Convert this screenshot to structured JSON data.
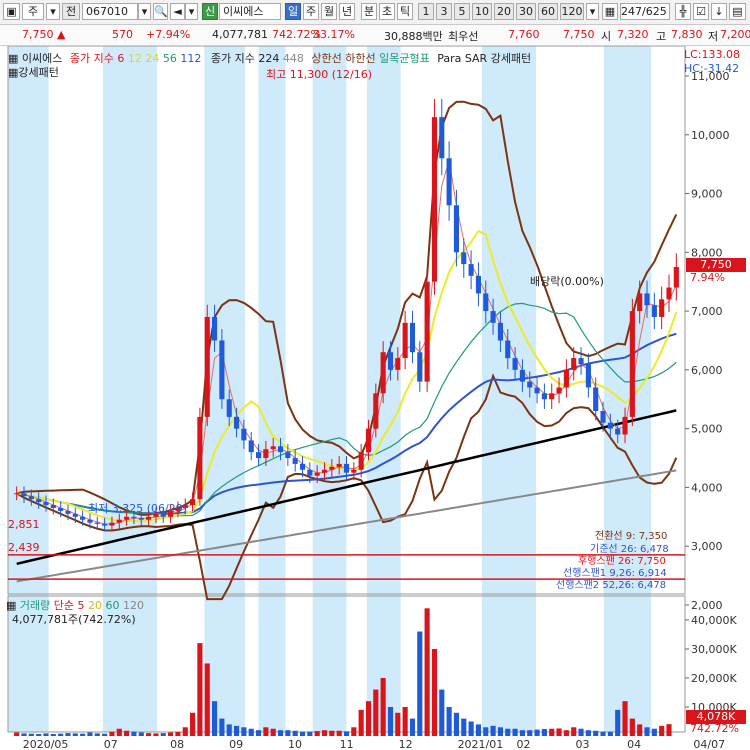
{
  "toolbar": {
    "type_label": "주",
    "period_label": "전",
    "code": "067010",
    "sin_badge": "신",
    "stock_name": "이씨에스",
    "periods": [
      "일",
      "주",
      "월",
      "년"
    ],
    "minute_btn": "분",
    "tick_btn": "초",
    "tick2_btn": "틱",
    "intervals": [
      "1",
      "3",
      "5",
      "10",
      "20",
      "30",
      "60",
      "120"
    ],
    "record_count": "247/625"
  },
  "info": {
    "price": "7,750",
    "change": "570",
    "change_pct": "+7.94%",
    "volume": "4,077,781",
    "volume_pct": "742.72%",
    "turnover_pct": "33.17%",
    "amount": "30,888백만",
    "best_bid_label": "최우선",
    "best_bid": "7,760",
    "best_ask": "7,750",
    "open_label": "시",
    "open": "7,320",
    "high_label": "고",
    "high": "7,830",
    "low_label": "저",
    "low": "7,200"
  },
  "colors": {
    "up": "#d9141a",
    "down": "#1f5bd8",
    "shade": "#cfeafb",
    "ma5": "#e66b6b",
    "ma20": "#ebeb28",
    "ma60": "#1f9a7a",
    "ma120": "#2f55c8",
    "ma224": "#000000",
    "ma448": "#888888",
    "bollinger": "#7a3410",
    "hline": "#d9141a"
  },
  "price_legend": {
    "name": "이씨에스",
    "ma_title": "종가 지수 6",
    "ma_values": [
      "12",
      "24",
      "56",
      "112"
    ],
    "ma2_title": "종가 지수 224",
    "ma2_values": [
      "448"
    ],
    "bands_upper": "상한선",
    "bands_lower": "하한선",
    "ichimoku": "일목균형표",
    "para": "Para SAR 강세패턴",
    "second_line": "강세패턴",
    "lc": "LC:133.08",
    "hc": "HC:-31.42"
  },
  "volume_legend": {
    "title": "거래량",
    "simple": "단순 5",
    "ma": [
      "20",
      "60",
      "120"
    ],
    "current": "4,077,781주(742.72%)"
  },
  "annotations": {
    "high_note": "최고 11,300 (12/16)",
    "low_note": "최저 3,325 (06/29)",
    "dividend": "배당락(0.00%)"
  },
  "right_labels": {
    "price_tag": "7,750",
    "pct_tag": "7.94%",
    "vol_tag": "4,078K",
    "vol_pct_tag": "742.72%"
  },
  "ichimoku_labels": [
    "전환선 9: 7,350",
    "기준선 26: 6,478",
    "후행스팬 26: 7,750",
    "선행스팬1 9,26: 6,914",
    "선행스팬2 52,26: 6,478"
  ],
  "hlines": [
    "2,851",
    "2,439"
  ],
  "chart_data": {
    "type": "line",
    "price_axis": {
      "min": 2000,
      "max": 11000,
      "ticks": [
        "2,000",
        "3,000",
        "4,000",
        "5,000",
        "6,000",
        "7,000",
        "8,000",
        "9,000",
        "10,000",
        "11,000"
      ]
    },
    "volume_axis": {
      "max": 40000,
      "ticks": [
        "10,000K",
        "20,000K",
        "30,000K",
        "40,000K"
      ]
    },
    "x_labels": [
      "2020/05",
      "07",
      "08",
      "09",
      "10",
      "11",
      "12",
      "2021/01",
      "02",
      "03",
      "04",
      "04/07"
    ],
    "close": [
      3900,
      3850,
      3800,
      3750,
      3700,
      3650,
      3600,
      3550,
      3500,
      3450,
      3400,
      3380,
      3350,
      3400,
      3450,
      3500,
      3480,
      3450,
      3500,
      3550,
      3500,
      3600,
      3650,
      3700,
      3800,
      5200,
      6900,
      6500,
      5500,
      5200,
      5000,
      4800,
      4600,
      4500,
      4650,
      4700,
      4600,
      4500,
      4400,
      4300,
      4200,
      4250,
      4300,
      4350,
      4400,
      4250,
      4300,
      4600,
      5000,
      5600,
      6300,
      6000,
      6200,
      6800,
      6300,
      5800,
      7500,
      10300,
      9600,
      8800,
      8000,
      7800,
      7600,
      7300,
      7000,
      6800,
      6500,
      6200,
      6000,
      5800,
      5700,
      5600,
      5500,
      5600,
      5700,
      6000,
      6200,
      6100,
      5700,
      5300,
      5100,
      5000,
      4900,
      5200,
      7000,
      7300,
      7100,
      6900,
      7200,
      7400,
      7750
    ],
    "volume": [
      1200,
      900,
      800,
      700,
      900,
      700,
      800,
      1000,
      900,
      800,
      1200,
      900,
      800,
      1500,
      2500,
      1800,
      1500,
      1200,
      1000,
      900,
      1000,
      1200,
      1400,
      3000,
      8000,
      32000,
      25000,
      12000,
      6000,
      4000,
      3500,
      3000,
      2500,
      2000,
      3000,
      2500,
      2000,
      2000,
      1800,
      1500,
      1500,
      1700,
      2000,
      1800,
      1800,
      1600,
      3000,
      9000,
      12000,
      16000,
      20000,
      10000,
      8000,
      10000,
      6000,
      36000,
      44000,
      30000,
      16000,
      10000,
      8000,
      6000,
      5000,
      4000,
      3000,
      3500,
      3000,
      2500,
      2500,
      2000,
      2000,
      2200,
      2400,
      2500,
      2600,
      2000,
      3000,
      2500,
      2000,
      1800,
      1500,
      1500,
      9000,
      12000,
      6000,
      4000,
      3000,
      2500,
      3500,
      4078
    ]
  }
}
